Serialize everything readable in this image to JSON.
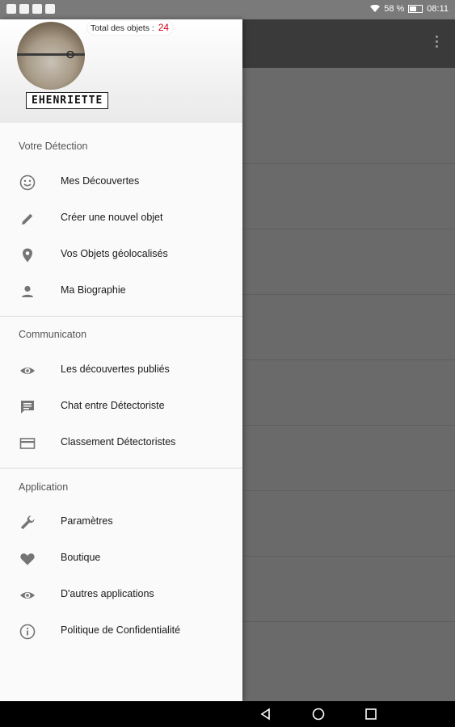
{
  "status_bar": {
    "battery": "58 %",
    "time": "08:11"
  },
  "drawer": {
    "header": {
      "username": "EHENRIETTE",
      "total_label": "Total des objets :",
      "total_count": "24"
    },
    "sections": [
      {
        "title": "Votre Détection",
        "items": [
          {
            "label": "Mes Découvertes",
            "icon": "smiley-icon"
          },
          {
            "label": "Créer une nouvel objet",
            "icon": "pencil-icon"
          },
          {
            "label": "Vos Objets géolocalisés",
            "icon": "location-pin-icon"
          },
          {
            "label": "Ma Biographie",
            "icon": "person-icon"
          }
        ]
      },
      {
        "title": "Communicaton",
        "items": [
          {
            "label": "Les découvertes publiés",
            "icon": "eye-icon"
          },
          {
            "label": "Chat entre Détectoriste",
            "icon": "chat-icon"
          },
          {
            "label": "Classement Détectoristes",
            "icon": "card-icon"
          }
        ]
      },
      {
        "title": "Application",
        "items": [
          {
            "label": "Paramètres",
            "icon": "wrench-icon"
          },
          {
            "label": "Boutique",
            "icon": "heart-icon"
          },
          {
            "label": "D'autres applications",
            "icon": "eye-icon"
          },
          {
            "label": "Politique de Confidentialité",
            "icon": "info-icon"
          }
        ]
      }
    ]
  },
  "colors": {
    "icon_gray": "#757575",
    "total_count": "#d0021b",
    "scrim": "#6a6a6a",
    "toolbar": "#3a3a3a"
  }
}
